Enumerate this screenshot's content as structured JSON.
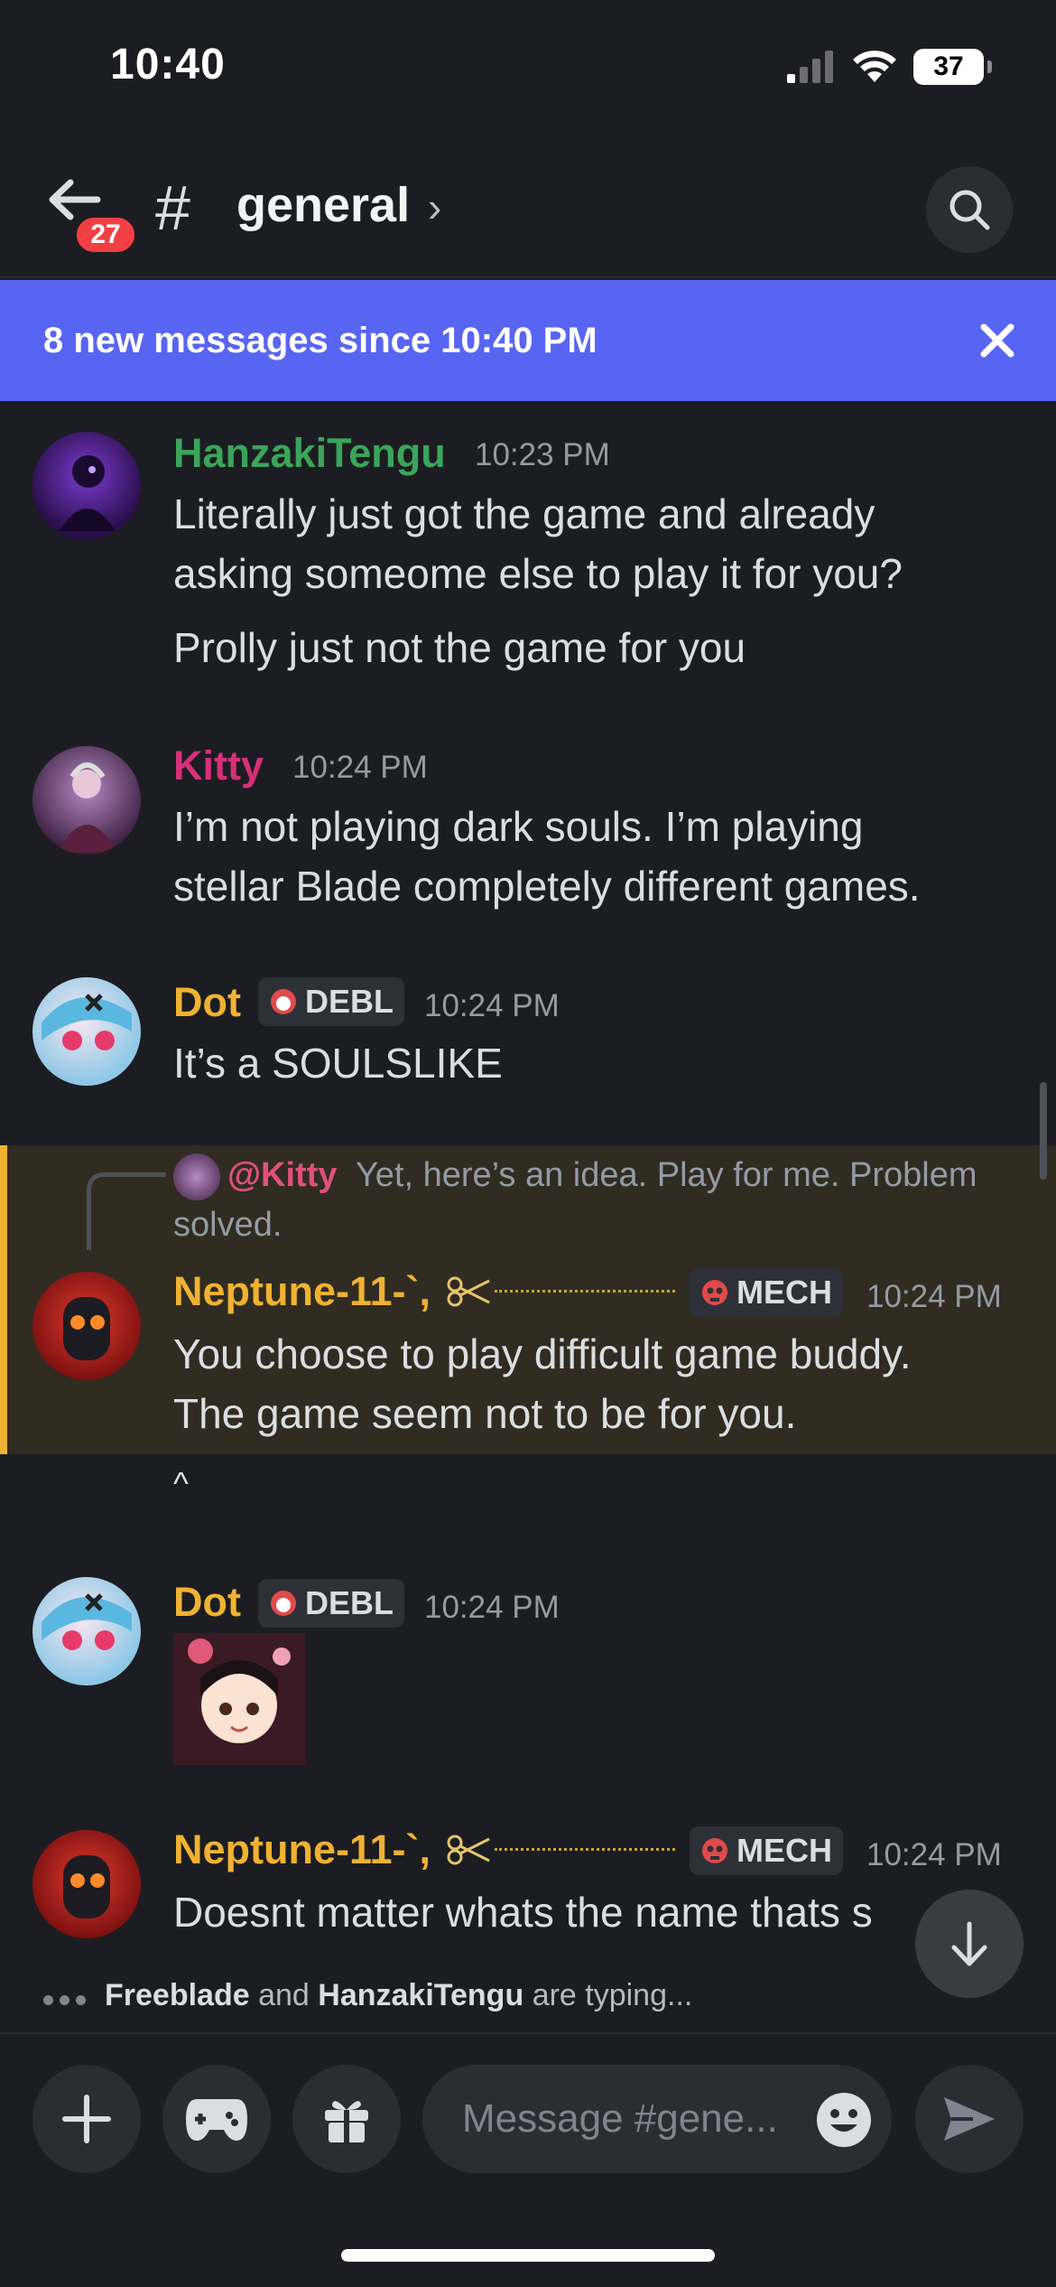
{
  "status_bar": {
    "time": "10:40",
    "battery": "37"
  },
  "header": {
    "unread_count": "27",
    "hash_symbol": "#",
    "channel_name": "general",
    "chevron": "›"
  },
  "banner": {
    "text": "8 new messages since 10:40 PM"
  },
  "messages": [
    {
      "author": "HanzakiTengu",
      "author_color": "#3ba55c",
      "time": "10:23 PM",
      "lines": [
        "Literally just got the game and already",
        "asking someome else to play it for you?"
      ],
      "followup": "Prolly just not the game for you"
    },
    {
      "author": "Kitty",
      "author_color": "#d5307a",
      "time": "10:24 PM",
      "lines": [
        "I’m not playing dark souls. I’m playing",
        "stellar Blade completely different games."
      ]
    },
    {
      "author": "Dot",
      "author_color": "#f0b232",
      "role_tag": "DEBL",
      "time": "10:24 PM",
      "lines": [
        "It’s a SOULSLIKE"
      ]
    },
    {
      "reply_mention": "@Kitty",
      "reply_text": "Yet, here’s an idea. Play for me. Problem solved.",
      "author": "Neptune-11-`,",
      "author_color": "#f0b232",
      "role_tag": "MECH",
      "time": "10:24 PM",
      "lines": [
        "You choose to play difficult game buddy.",
        "The game seem not to be for you."
      ],
      "followup": "^"
    },
    {
      "author": "Dot",
      "author_color": "#f0b232",
      "role_tag": "DEBL",
      "time": "10:24 PM",
      "sticker": "anime-girl-sticker"
    },
    {
      "author": "Neptune-11-`,",
      "author_color": "#f0b232",
      "role_tag": "MECH",
      "time": "10:24 PM",
      "lines": [
        "Doesnt matter whats the name thats s"
      ]
    }
  ],
  "typing": {
    "user1": "Freeblade",
    "and": "and",
    "user2": "HanzakiTengu",
    "suffix": "are typing..."
  },
  "composer": {
    "placeholder": "Message #gene..."
  },
  "icons": {
    "back": "back-arrow-icon",
    "search": "search-icon",
    "close": "close-icon",
    "plus": "plus-icon",
    "gamepad": "gamepad-icon",
    "gift": "gift-icon",
    "emoji": "emoji-icon",
    "send": "send-icon",
    "scroll": "arrow-down-icon"
  }
}
